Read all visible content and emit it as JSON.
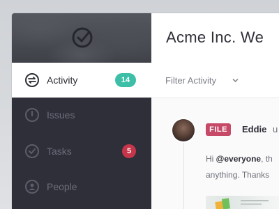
{
  "app": {
    "title": "Acme Inc. We"
  },
  "sidebar": {
    "items": [
      {
        "label": "Activity",
        "icon": "activity-icon",
        "badge": "14",
        "active": true
      },
      {
        "label": "Issues",
        "icon": "issues-icon",
        "badge": null,
        "active": false
      },
      {
        "label": "Tasks",
        "icon": "tasks-icon",
        "badge": "5",
        "active": false
      },
      {
        "label": "People",
        "icon": "people-icon",
        "badge": null,
        "active": false
      }
    ]
  },
  "filter": {
    "label": "Filter Activity"
  },
  "feed": {
    "item": {
      "tag": "FILE",
      "author": "Eddie",
      "action_fragment": "u",
      "mention_prefix": "Hi ",
      "mention": "@everyone",
      "mention_suffix": ", th",
      "body_line2": "anything. Thanks"
    }
  },
  "colors": {
    "sidebar_bg": "#2f2f3a",
    "accent_teal": "#3cbfa6",
    "accent_red": "#c6364b",
    "file_tag": "#c64a68"
  }
}
